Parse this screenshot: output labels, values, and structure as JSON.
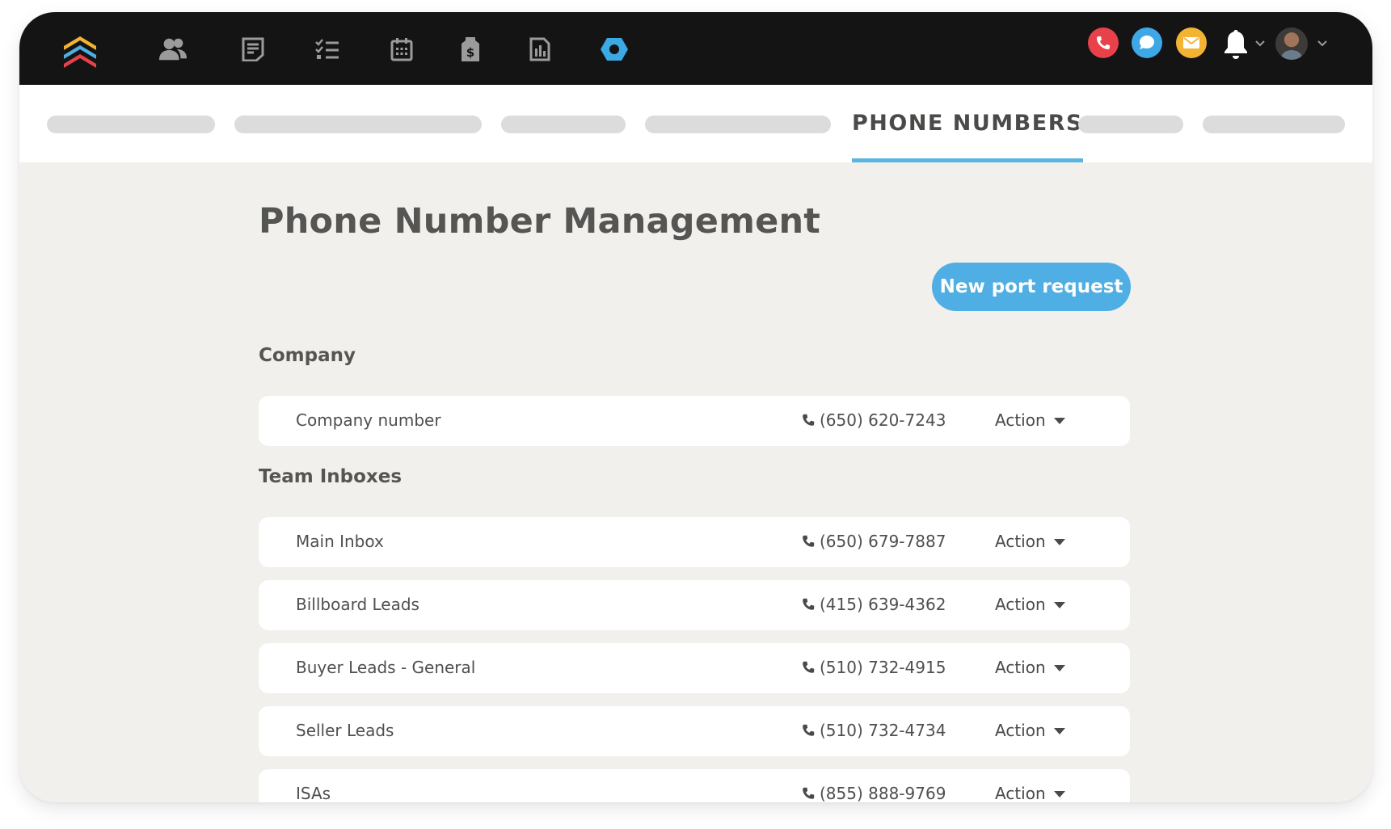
{
  "nav": {
    "icons": [
      "people-icon",
      "notes-icon",
      "tasks-icon",
      "calendar-icon",
      "deals-icon",
      "reports-icon",
      "admin-hexagon-icon"
    ],
    "status_buttons": [
      {
        "name": "phone-call-icon",
        "color": "#e8414a"
      },
      {
        "name": "chat-bubble-icon",
        "color": "#3ea7e6"
      },
      {
        "name": "mail-icon",
        "color": "#f3b434"
      }
    ],
    "accent": "#3ba9e3"
  },
  "tabs": {
    "active_label": "PHONE NUMBERS",
    "placeholder_count": 6
  },
  "page": {
    "title": "Phone Number Management",
    "new_port_label": "New port request"
  },
  "sections": [
    {
      "title": "Company",
      "rows": [
        {
          "name": "Company number",
          "phone": "(650) 620-7243",
          "action": "Action"
        }
      ]
    },
    {
      "title": "Team Inboxes",
      "rows": [
        {
          "name": "Main Inbox",
          "phone": "(650) 679-7887",
          "action": "Action"
        },
        {
          "name": "Billboard Leads",
          "phone": "(415) 639-4362",
          "action": "Action"
        },
        {
          "name": "Buyer Leads - General",
          "phone": "(510) 732-4915",
          "action": "Action"
        },
        {
          "name": "Seller Leads",
          "phone": "(510) 732-4734",
          "action": "Action"
        },
        {
          "name": "ISAs",
          "phone": "(855) 888-9769",
          "action": "Action"
        }
      ]
    }
  ]
}
